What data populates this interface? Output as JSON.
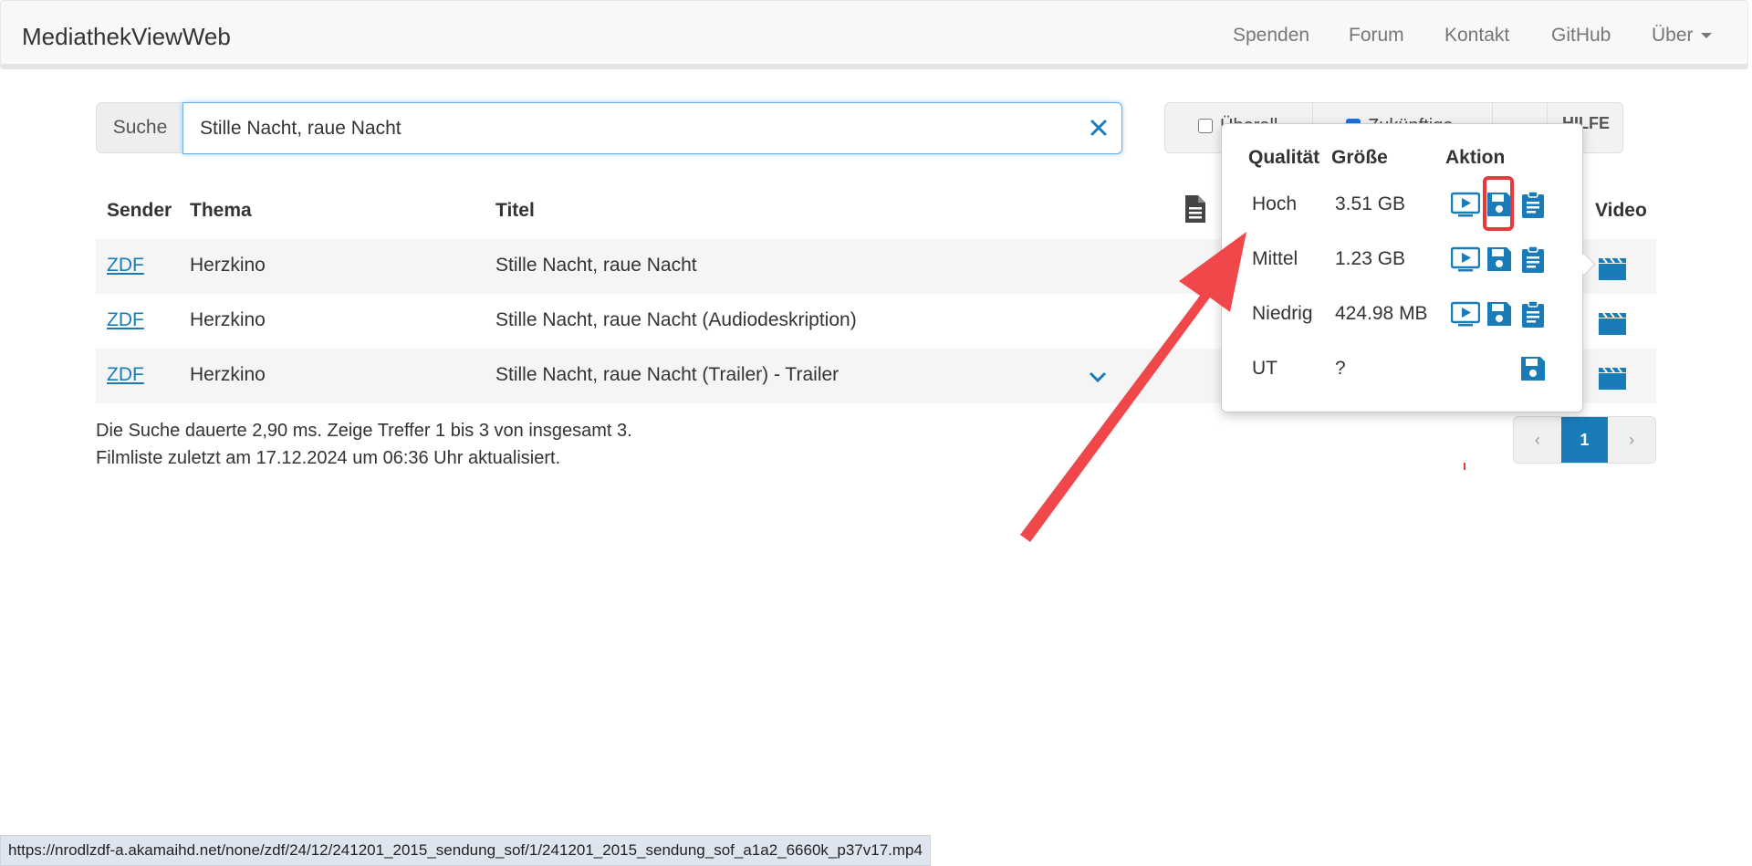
{
  "navbar": {
    "brand": "MediathekViewWeb",
    "links": [
      "Spenden",
      "Forum",
      "Kontakt",
      "GitHub",
      "Über"
    ]
  },
  "search": {
    "addon_label": "Suche",
    "value": "Stille Nacht, raue Nacht",
    "options": [
      {
        "label": "Überall",
        "checked": false
      },
      {
        "label": "Zukünftige",
        "checked": true
      }
    ],
    "help_label": "HILFE"
  },
  "table": {
    "headers": [
      "Sender",
      "Thema",
      "Titel",
      "Video"
    ],
    "rows": [
      {
        "sender": "ZDF",
        "thema": "Herzkino",
        "titel": "Stille Nacht, raue Nacht"
      },
      {
        "sender": "ZDF",
        "thema": "Herzkino",
        "titel": "Stille Nacht, raue Nacht (Audiodeskription)"
      },
      {
        "sender": "ZDF",
        "thema": "Herzkino",
        "titel": "Stille Nacht, raue Nacht (Trailer) - Trailer"
      }
    ]
  },
  "summary": {
    "line1": "Die Suche dauerte 2,90 ms. Zeige Treffer 1 bis 3 von insgesamt 3.",
    "line2": "Filmliste zuletzt am 17.12.2024 um 06:36 Uhr aktualisiert."
  },
  "pagination": {
    "prev": "‹",
    "current": "1",
    "next": "›"
  },
  "popover": {
    "headers": [
      "Qualität",
      "Größe",
      "Aktion"
    ],
    "rows": [
      {
        "quality": "Hoch",
        "size": "3.51 GB"
      },
      {
        "quality": "Mittel",
        "size": "1.23 GB"
      },
      {
        "quality": "Niedrig",
        "size": "424.98 MB"
      },
      {
        "quality": "UT",
        "size": "?"
      }
    ]
  },
  "status_url": "https://nrodlzdf-a.akamaihd.net/none/zdf/24/12/241201_2015_sendung_sof/1/241201_2015_sendung_sof_a1a2_6660k_p37v17.mp4",
  "colors": {
    "accent": "#1a7bb9",
    "annotation": "#e8393a"
  }
}
